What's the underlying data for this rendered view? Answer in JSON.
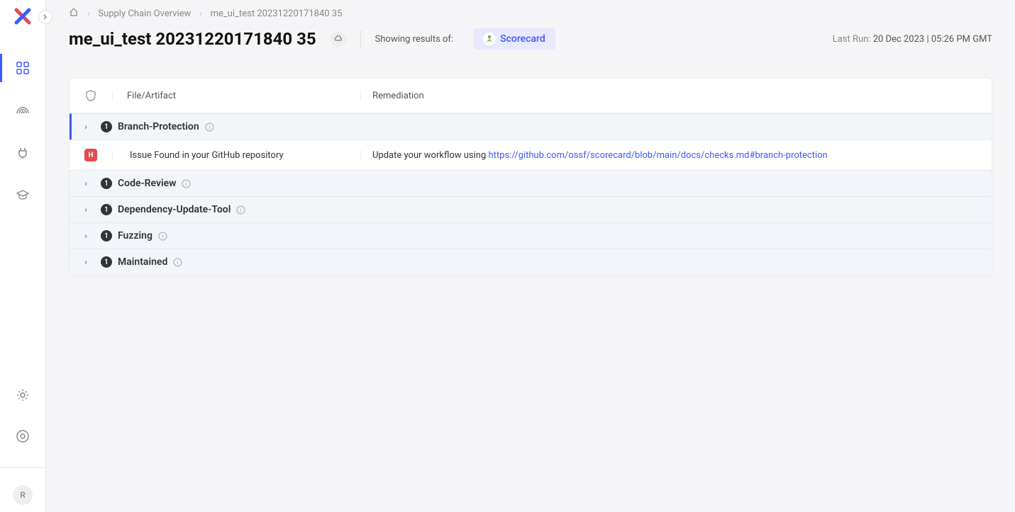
{
  "sidebar": {
    "user_initial": "R"
  },
  "breadcrumb": {
    "link1": "Supply Chain Overview",
    "current": "me_ui_test 20231220171840 35"
  },
  "header": {
    "title": "me_ui_test 20231220171840 35",
    "showing_label": "Showing results of:",
    "chip_label": "Scorecard",
    "last_run_label": "Last Run: ",
    "last_run_value": "20 Dec 2023 | 05:26 PM GMT"
  },
  "table": {
    "col_file": "File/Artifact",
    "col_rem": "Remediation",
    "groups": [
      {
        "name": "Branch-Protection",
        "count": "1",
        "expanded": true,
        "detail": {
          "severity": "H",
          "file": "Issue Found in your GitHub repository",
          "rem_prefix": "Update your workflow using ",
          "rem_link": "https://github.com/ossf/scorecard/blob/main/docs/checks.md#branch-protection"
        }
      },
      {
        "name": "Code-Review",
        "count": "1",
        "expanded": false
      },
      {
        "name": "Dependency-Update-Tool",
        "count": "1",
        "expanded": false
      },
      {
        "name": "Fuzzing",
        "count": "1",
        "expanded": false
      },
      {
        "name": "Maintained",
        "count": "1",
        "expanded": false
      }
    ]
  }
}
